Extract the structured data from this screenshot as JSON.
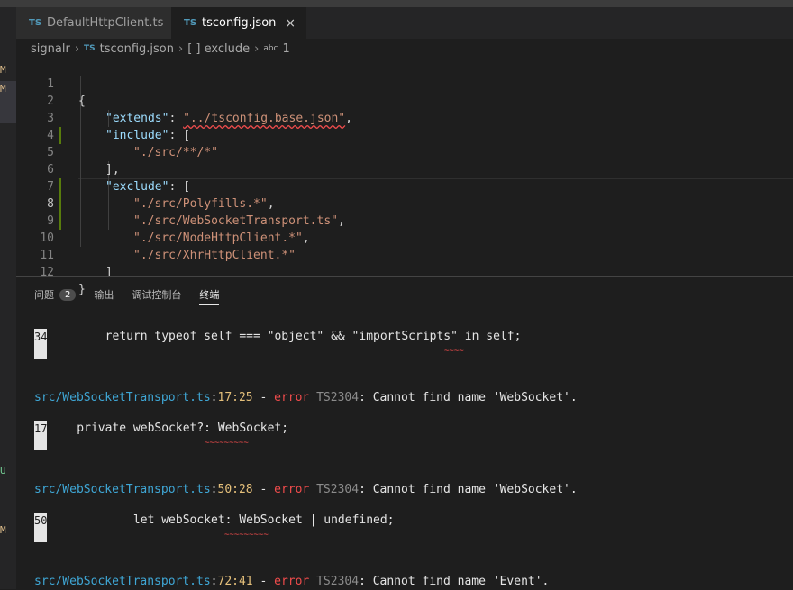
{
  "tabs": [
    {
      "badge": "TS",
      "label": "DefaultHttpClient.ts"
    },
    {
      "badge": "TS",
      "label": "tsconfig.json",
      "close": "×"
    }
  ],
  "breadcrumb": {
    "root": "signalr",
    "file_badge": "TS",
    "file": "tsconfig.json",
    "key": "[ ] exclude",
    "item_badge": "abc",
    "item": "1"
  },
  "leftbar_marks": [
    "M",
    "M",
    "U",
    "M"
  ],
  "editor": {
    "line_numbers": [
      "1",
      "2",
      "3",
      "4",
      "5",
      "6",
      "7",
      "8",
      "9",
      "10",
      "11",
      "12"
    ],
    "lines": {
      "l1": "{",
      "l2_key": "\"extends\"",
      "l2_colon": ": ",
      "l2_val": "\"../tsconfig.base.json\"",
      "l2_tail": ",",
      "l3_key": "\"include\"",
      "l3_tail": ": [",
      "l4_val": "\"./src/**/*\"",
      "l5": "],",
      "l6_key": "\"exclude\"",
      "l6_tail": ": [",
      "l7_val": "\"./src/Polyfills.*\"",
      "l7_tail": ",",
      "l8_val": "\"./src/WebSocketTransport.ts\"",
      "l8_tail": ",",
      "l9_val": "\"./src/NodeHttpClient.*\"",
      "l9_tail": ",",
      "l10_val": "\"./src/XhrHttpClient.*\"",
      "l11": "]",
      "l12": "}"
    }
  },
  "panel": {
    "tabs": [
      "问题",
      "输出",
      "调试控制台",
      "终端"
    ],
    "problems_count": "2"
  },
  "terminal": {
    "block1": {
      "num": "34",
      "code_pre": "        return typeof self === \"object\" && \"importScripts\" in ",
      "code_err": "self",
      "code_post": ";",
      "squiggle": "~~~~"
    },
    "error1": {
      "file": "src/WebSocketTransport.ts",
      "sep1": ":",
      "pos": "17:25",
      "dash": " - ",
      "err": "error",
      "code": " TS2304",
      "msg": ": Cannot find name 'WebSocket'."
    },
    "block2": {
      "num": "17",
      "code_pre": "    private webSocket?: ",
      "code_err": "WebSocket",
      "code_post": ";",
      "squiggle": "~~~~~~~~~"
    },
    "error2": {
      "file": "src/WebSocketTransport.ts",
      "sep1": ":",
      "pos": "50:28",
      "dash": " - ",
      "err": "error",
      "code": " TS2304",
      "msg": ": Cannot find name 'WebSocket'."
    },
    "block3": {
      "num": "50",
      "code_pre": "            let webSocket: ",
      "code_err": "WebSocket",
      "code_post": " | undefined;",
      "squiggle": "~~~~~~~~~"
    },
    "error3": {
      "file": "src/WebSocketTransport.ts",
      "sep1": ":",
      "pos": "72:41",
      "dash": " - ",
      "err": "error",
      "code": " TS2304",
      "msg": ": Cannot find name 'Event'."
    }
  }
}
